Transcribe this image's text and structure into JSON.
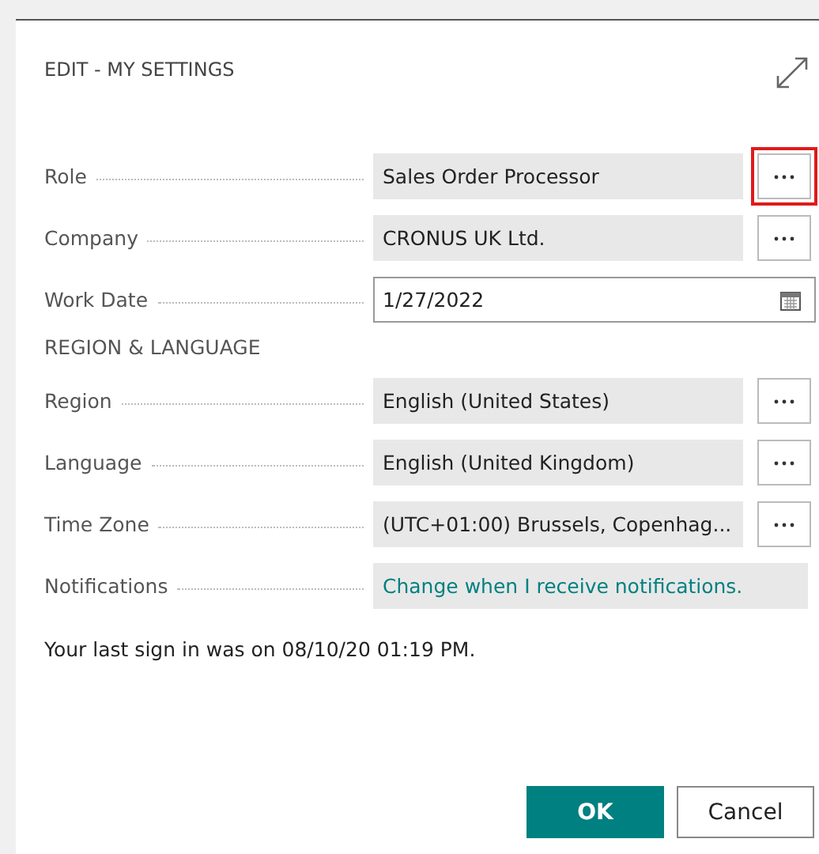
{
  "dialog": {
    "title": "EDIT - MY SETTINGS"
  },
  "fields": [
    {
      "kind": "lookup",
      "label": "Role",
      "value": "Sales Order Processor",
      "highlighted": true
    },
    {
      "kind": "lookup",
      "label": "Company",
      "value": "CRONUS UK Ltd.",
      "highlighted": false
    },
    {
      "kind": "date",
      "label": "Work Date",
      "value": "1/27/2022"
    },
    {
      "kind": "heading",
      "label": "REGION & LANGUAGE"
    },
    {
      "kind": "lookup",
      "label": "Region",
      "value": "English (United States)",
      "highlighted": false
    },
    {
      "kind": "lookup",
      "label": "Language",
      "value": "English (United Kingdom)",
      "highlighted": false
    },
    {
      "kind": "lookup",
      "label": "Time Zone",
      "value": "(UTC+01:00) Brussels, Copenhag...",
      "highlighted": false
    },
    {
      "kind": "link",
      "label": "Notifications",
      "value": "Change when I receive notifications."
    }
  ],
  "last_sign_in": "Your last sign in was on 08/10/20 01:19 PM.",
  "buttons": [
    {
      "label": "OK",
      "kind": "primary"
    },
    {
      "label": "Cancel",
      "kind": "secondary"
    }
  ]
}
